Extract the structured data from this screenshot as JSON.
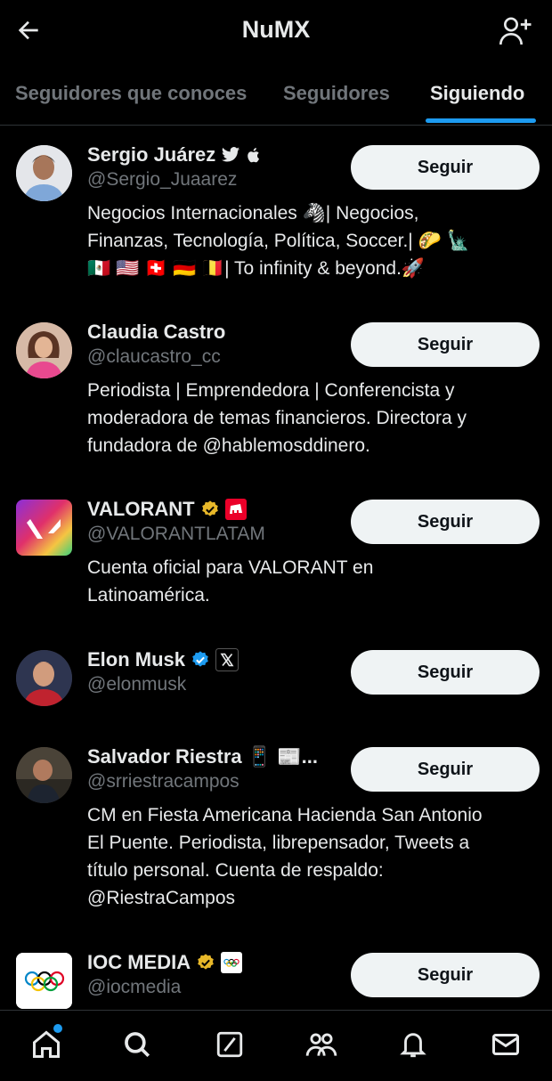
{
  "header": {
    "title": "NuMX"
  },
  "tabs": [
    {
      "label": "Seguidores que conoces"
    },
    {
      "label": "Seguidores"
    },
    {
      "label": "Siguiendo"
    }
  ],
  "users": [
    {
      "name": "Sergio Juárez",
      "handle": "@Sergio_Juaarez",
      "button": "Seguir",
      "bio": [
        "Negocios Internacionales 🦓| Negocios,",
        "Finanzas, Tecnología, Política, Soccer.| 🌮 🗽",
        "🇲🇽 🇺🇸 🇨🇭 🇩🇪 🇧🇪| To infinity & beyond.🚀"
      ]
    },
    {
      "name": "Claudia Castro",
      "handle": "@claucastro_cc",
      "button": "Seguir",
      "bio": [
        "Periodista | Emprendedora | Conferencista y",
        "moderadora de temas financieros. Directora y",
        "fundadora de @hablemosddinero."
      ]
    },
    {
      "name": "VALORANT",
      "handle": "@VALORANTLATAM",
      "button": "Seguir",
      "bio": [
        "Cuenta oficial para VALORANT en",
        "Latinoamérica."
      ]
    },
    {
      "name": "Elon Musk",
      "handle": "@elonmusk",
      "button": "Seguir",
      "bio": []
    },
    {
      "name": "Salvador Riestra 📱 📰...",
      "handle": "@srriestracampos",
      "button": "Seguir",
      "bio": [
        "CM en Fiesta Americana Hacienda San Antonio",
        "El Puente. Periodista, librepensador, Tweets a",
        "título personal. Cuenta de respaldo:",
        "@RiestraCampos"
      ]
    },
    {
      "name": "IOC MEDIA",
      "handle": "@iocmedia",
      "button": "Seguir",
      "bio": []
    }
  ],
  "colors": {
    "accent": "#1d9bf0",
    "gold_badge": "#e8b829",
    "text": "#e7e9ea",
    "muted": "#71767b"
  },
  "icons": {
    "back": "arrow-left-icon",
    "add_user": "user-plus-icon"
  },
  "bottom_nav": [
    {
      "name": "home-icon"
    },
    {
      "name": "search-icon"
    },
    {
      "name": "grok-icon"
    },
    {
      "name": "communities-icon"
    },
    {
      "name": "notifications-icon"
    },
    {
      "name": "messages-icon"
    }
  ]
}
